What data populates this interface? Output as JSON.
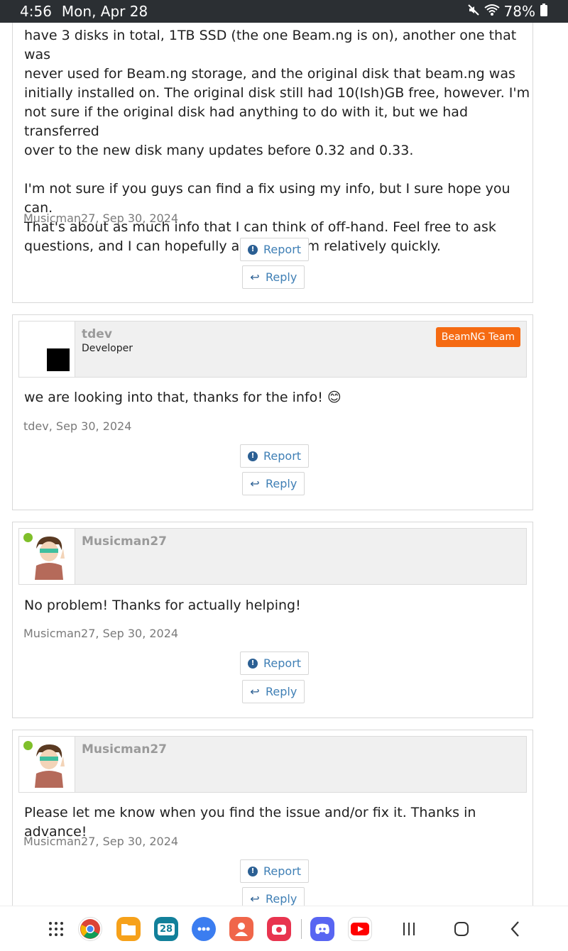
{
  "status_bar": {
    "time": "4:56",
    "date": "Mon, Apr 28",
    "battery": "78%"
  },
  "posts": [
    {
      "body": [
        "have 3 disks in total, 1TB SSD (the one Beam.ng is on), another one that was",
        "never used for Beam.ng storage, and the original disk that beam.ng was",
        "initially installed on. The original disk still had 10(Ish)GB free, however. I'm",
        "not sure if the original disk had anything to do with it, but we had transferred",
        "over to the new disk many updates before 0.32 and 0.33.",
        "",
        "I'm not sure if you guys can find a fix using my info, but I sure hope you can.",
        "That's about as much info that I can think of off-hand. Feel free to ask",
        "questions, and I can hopefully answer them relatively quickly."
      ],
      "meta": "Musicman27, Sep 30, 2024",
      "report_label": "Report",
      "reply_label": "Reply"
    },
    {
      "username": "tdev",
      "user_title": "Developer",
      "badge": "BeamNG Team",
      "body": "we are looking into that, thanks for the info! 😊",
      "meta": "tdev, Sep 30, 2024",
      "report_label": "Report",
      "reply_label": "Reply"
    },
    {
      "username": "Musicman27",
      "body": "No problem! Thanks for actually helping!",
      "meta": "Musicman27, Sep 30, 2024",
      "report_label": "Report",
      "reply_label": "Reply"
    },
    {
      "username": "Musicman27",
      "body": "Please let me know when you find the issue and/or fix it. Thanks in advance!",
      "meta": "Musicman27, Sep 30, 2024",
      "report_label": "Report",
      "reply_label": "Reply"
    }
  ],
  "nav_bar": {
    "calendar_day": "28",
    "apps": [
      "app-drawer-icon",
      "chrome-icon",
      "files-icon",
      "calendar-icon",
      "messages-icon",
      "contacts-icon",
      "camera-icon",
      "discord-icon",
      "youtube-icon"
    ],
    "colors": {
      "badge": "#f56a12",
      "link": "#3f7fb5",
      "online": "#7fbf2a"
    }
  }
}
